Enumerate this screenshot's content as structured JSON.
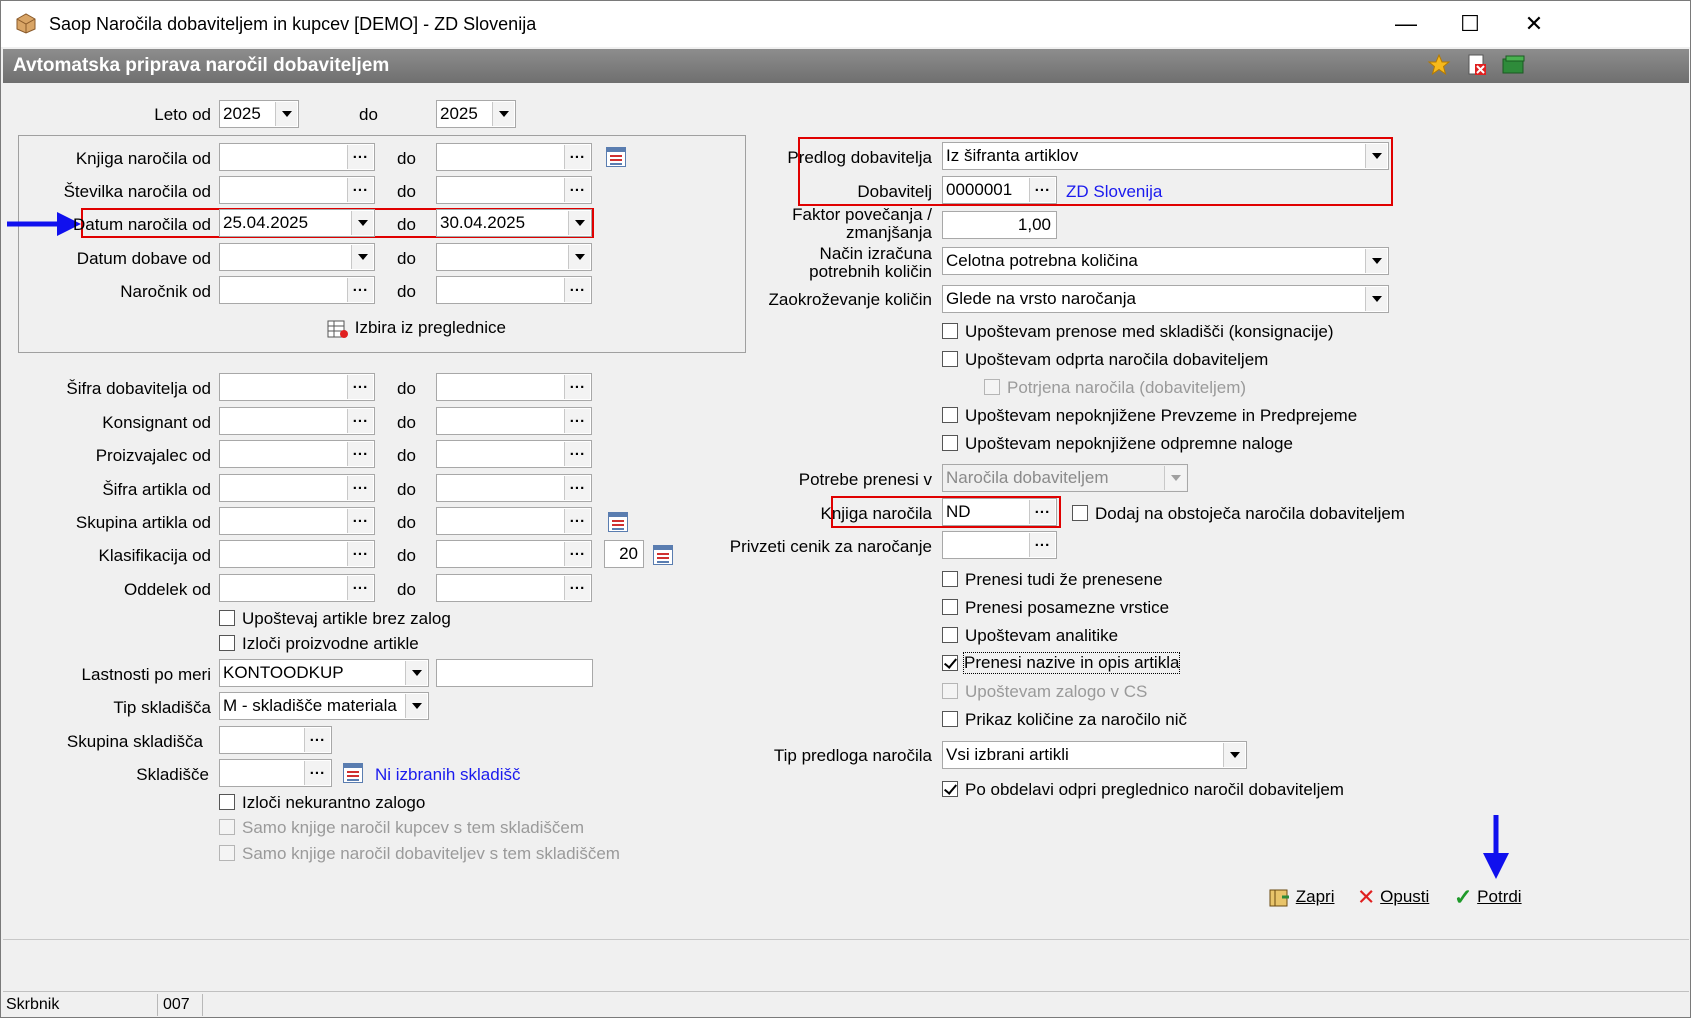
{
  "window": {
    "title": "Saop Naročila dobaviteljem in kupcev [DEMO] - ZD Slovenija",
    "subtitle": "Avtomatska priprava naročil dobaviteljem"
  },
  "left": {
    "leto_od_label": "Leto od",
    "leto_od_value": "2025",
    "do": "do",
    "leto_do_value": "2025",
    "knjiga_label": "Knjiga naročila od",
    "stevilka_label": "Številka naročila od",
    "datum_label": "Datum naročila od",
    "datum_od_value": "25.04.2025",
    "datum_do_value": "30.04.2025",
    "dobava_label": "Datum dobave od",
    "narocnik_label": "Naročnik od",
    "izbira_label": "Izbira iz preglednice",
    "sifra_dob_label": "Šifra dobavitelja od",
    "konsignant_label": "Konsignant od",
    "proizvajalec_label": "Proizvajalec od",
    "sifra_art_label": "Šifra artikla od",
    "skupina_art_label": "Skupina artikla od",
    "klasifikacija_label": "Klasifikacija od",
    "klasifikacija_num": "20",
    "oddelek_label": "Oddelek od",
    "chk_brez_zalog": "Upoštevaj artikle brez zalog",
    "chk_izloci_proiz": "Izloči proizvodne artikle",
    "lastnosti_label": "Lastnosti po meri",
    "lastnosti_value": "KONTOODKUP",
    "tip_sklad_label": "Tip skladišča",
    "tip_sklad_value": "M - skladišče materiala",
    "skupina_sklad_label": "Skupina skladišča",
    "skladisce_label": "Skladišče",
    "skladisce_link": "Ni izbranih skladišč",
    "chk_nekurantno": "Izloči nekurantno zalogo",
    "chk_samo_kupcev": "Samo knjige naročil kupcev s tem skladiščem",
    "chk_samo_dob": "Samo knjige naročil dobaviteljev s tem skladiščem"
  },
  "right": {
    "predlog_label": "Predlog dobavitelja",
    "predlog_value": "Iz šifranta artiklov",
    "dobavitelj_label": "Dobavitelj",
    "dobavitelj_value": "0000001",
    "dobavitelj_link": "ZD Slovenija",
    "faktor_label_1": "Faktor povečanja /",
    "faktor_label_2": "zmanjšanja",
    "faktor_value": "1,00",
    "nacin_label_1": "Način izračuna",
    "nacin_label_2": "potrebnih količin",
    "nacin_value": "Celotna potrebna količina",
    "zaokr_label": "Zaokroževanje količin",
    "zaokr_value": "Glede na vrsto naročanja",
    "chk_prenose": "Upoštevam prenose med skladišči (konsignacije)",
    "chk_odprta": "Upoštevam odprta naročila dobaviteljem",
    "chk_potrjena": "Potrjena naročila (dobaviteljem)",
    "chk_prevzeme": "Upoštevam nepoknjižene Prevzeme in Predprejeme",
    "chk_odpremne": "Upoštevam nepoknjižene odpremne naloge",
    "potrebe_label": "Potrebe prenesi v",
    "potrebe_value": "Naročila dobaviteljem",
    "knjiga_label": "Knjiga naročila",
    "knjiga_value": "ND",
    "chk_dodaj": "Dodaj na obstoječa naročila dobaviteljem",
    "cenik_label": "Privzeti cenik za naročanje",
    "chk_prenesene": "Prenesi tudi že prenesene",
    "chk_posamezne": "Prenesi posamezne vrstice",
    "chk_analitike": "Upoštevam analitike",
    "chk_nazive": "Prenesi nazive in opis artikla",
    "chk_zalogo_cs": "Upoštevam zalogo v CS",
    "chk_kolicine_nic": "Prikaz količine za naročilo nič",
    "tip_predloga_label": "Tip predloga naročila",
    "tip_predloga_value": "Vsi izbrani artikli",
    "chk_po_obdelavi": "Po obdelavi odpri preglednico naročil dobaviteljem"
  },
  "buttons": {
    "zapri": "Zapri",
    "opusti": "Opusti",
    "potrdi": "Potrdi"
  },
  "status": {
    "user": "Skrbnik",
    "code": "007"
  },
  "colors": {
    "highlight": "#e00000",
    "annotation_arrow": "#1010ee",
    "link": "#1a1aee"
  }
}
